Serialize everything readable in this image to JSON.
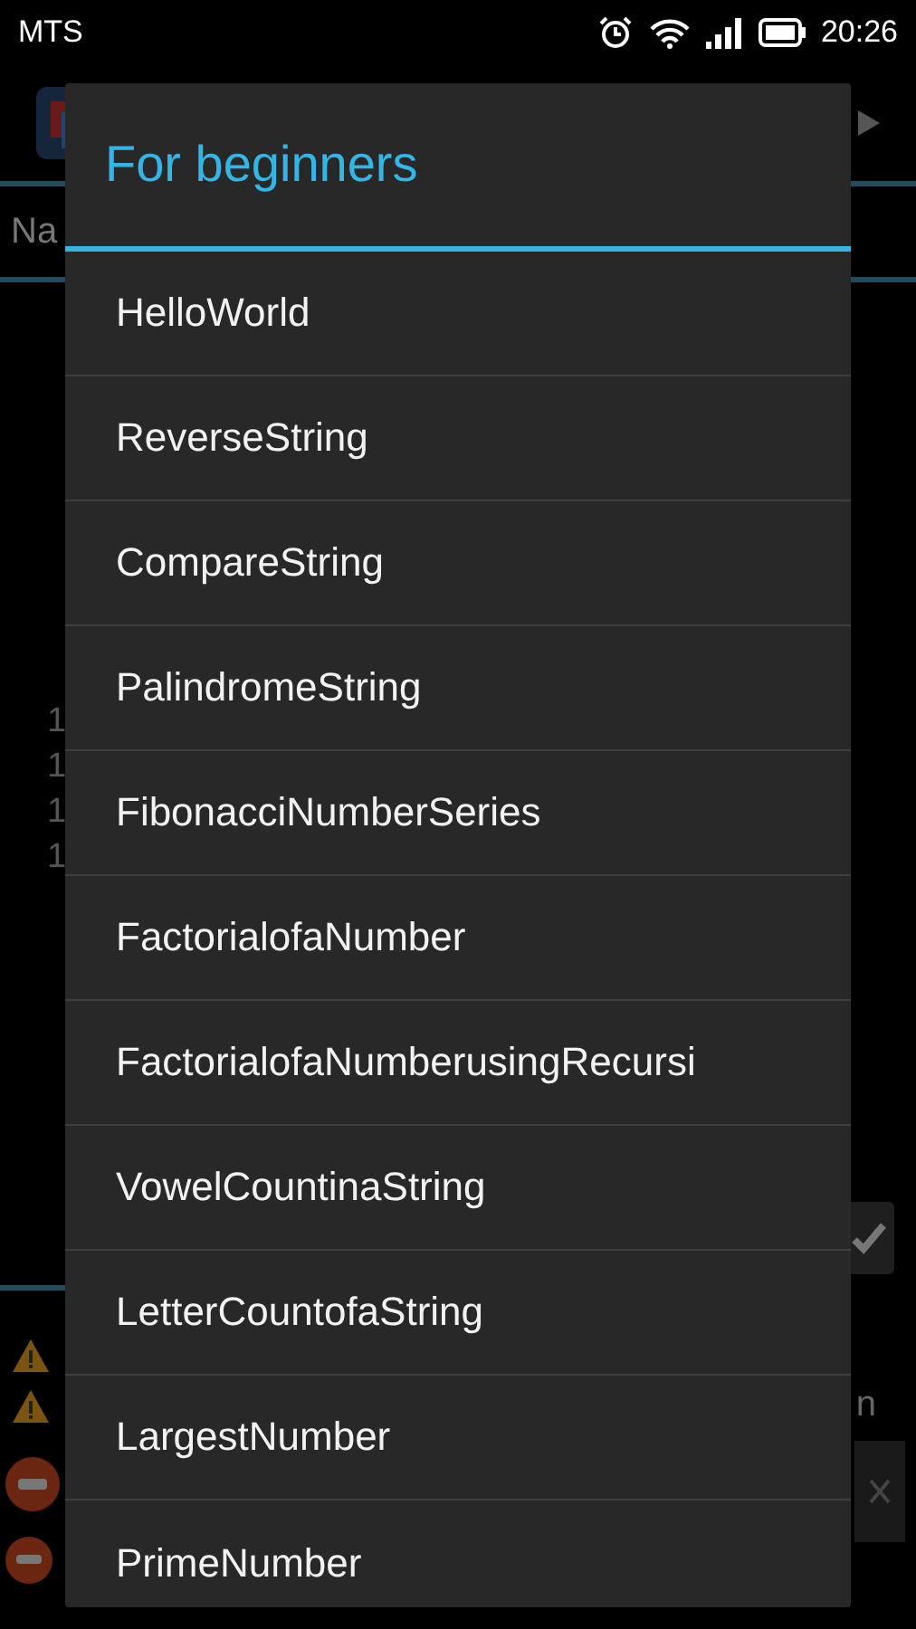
{
  "status_bar": {
    "carrier": "MTS",
    "time": "20:26"
  },
  "background": {
    "tab_label": "Na",
    "line_numbers": [
      "1",
      "1",
      "1",
      "1"
    ],
    "side_text": "n"
  },
  "dialog": {
    "title": "For beginners",
    "items": [
      {
        "label": "HelloWorld"
      },
      {
        "label": "ReverseString"
      },
      {
        "label": "CompareString"
      },
      {
        "label": "PalindromeString"
      },
      {
        "label": "FibonacciNumberSeries"
      },
      {
        "label": "FactorialofaNumber"
      },
      {
        "label": "FactorialofaNumberusingRecursi"
      },
      {
        "label": "VowelCountinaString"
      },
      {
        "label": "LetterCountofaString"
      },
      {
        "label": "LargestNumber"
      },
      {
        "label": "PrimeNumber"
      }
    ]
  }
}
